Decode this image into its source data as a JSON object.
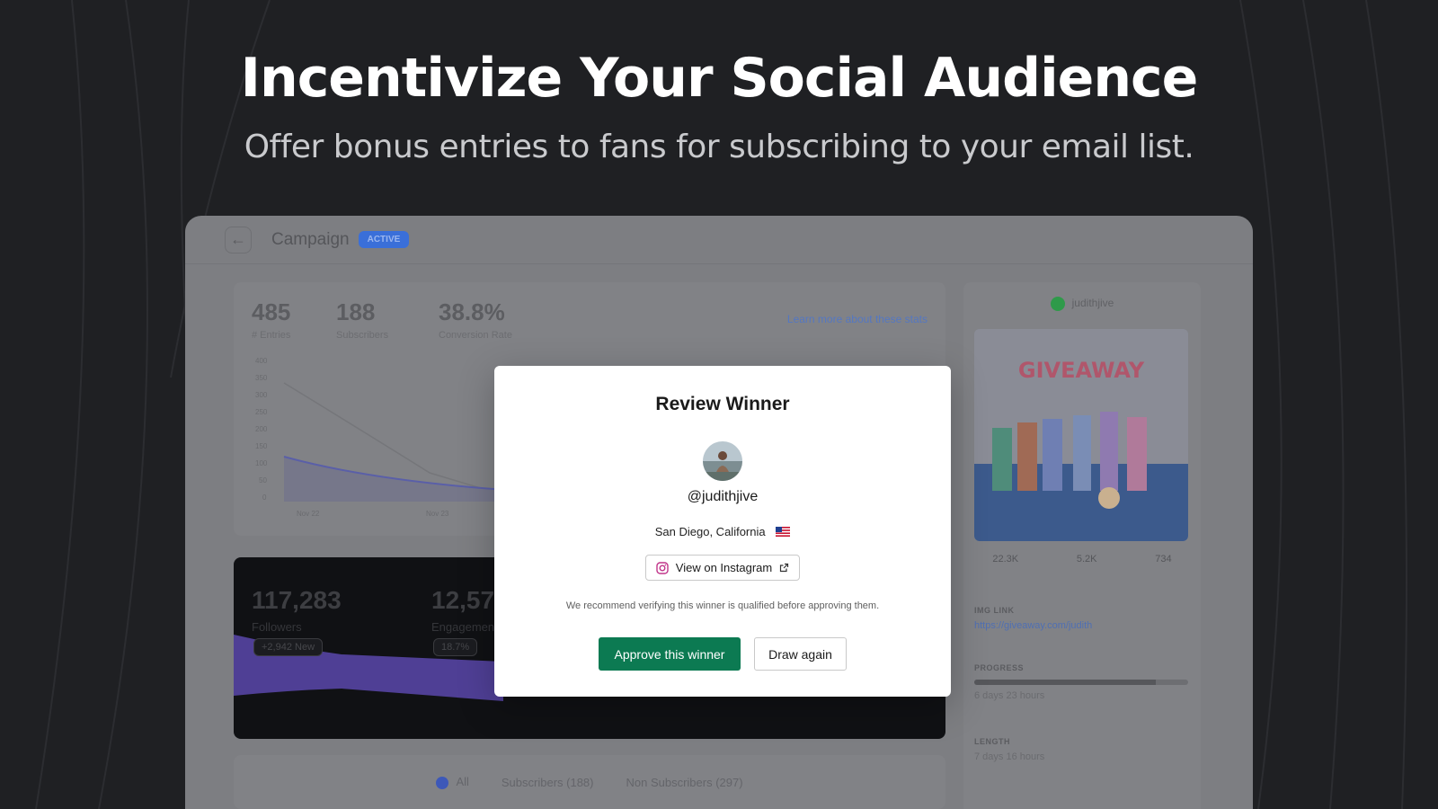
{
  "hero": {
    "title": "Incentivize Your Social Audience",
    "subtitle": "Offer bonus entries to fans for subscribing to your email list."
  },
  "app": {
    "title": "Campaign",
    "status": "ACTIVE",
    "stats": [
      {
        "value": "485",
        "label": "# Entries"
      },
      {
        "value": "188",
        "label": "Subscribers"
      },
      {
        "value": "38.8%",
        "label": "Conversion Rate"
      }
    ],
    "learn_more": "Learn more about these stats",
    "chart_y_ticks": [
      "400",
      "350",
      "300",
      "250",
      "200",
      "150",
      "100",
      "50",
      "0"
    ],
    "chart_x_ticks": [
      "Nov 22",
      "Nov 23"
    ],
    "social_stats": [
      {
        "value": "117,283",
        "label": "Followers",
        "chip": "+2,942 New"
      },
      {
        "value": "12,57",
        "label": "Engagement",
        "chip": "18.7%"
      }
    ],
    "filters": [
      "All",
      "Subscribers (188)",
      "Non Subscribers (297)"
    ],
    "side": {
      "username": "judithjive",
      "image_text": "GIVEAWAY",
      "metrics": [
        "22.3K",
        "5.2K",
        "734"
      ],
      "url_label": "IMG LINK",
      "url_value": "https://giveaway.com/judith",
      "progress_label": "PROGRESS",
      "progress_value": "6 days 23 hours",
      "progress_fraction": 0.85,
      "length_label": "LENGTH",
      "length_value": "7 days 16 hours"
    }
  },
  "modal": {
    "title": "Review Winner",
    "handle": "@judithjive",
    "location": "San Diego, California",
    "instagram_label": "View on Instagram",
    "recommend": "We recommend verifying this winner is qualified before approving them.",
    "approve_label": "Approve this winner",
    "draw_label": "Draw again",
    "colors": {
      "approve": "#0c7a52"
    }
  }
}
